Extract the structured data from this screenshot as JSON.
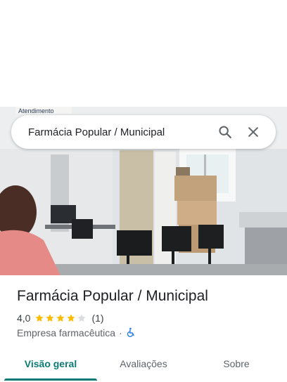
{
  "search": {
    "query": "Farmácia Popular / Municipal",
    "search_icon": "search-icon",
    "close_icon": "close-icon"
  },
  "photo": {
    "sign_text": "Atendimento"
  },
  "place": {
    "name": "Farmácia Popular / Municipal",
    "rating": "4,0",
    "rating_value": 4.0,
    "stars_filled": 4,
    "stars_total": 5,
    "review_count": "(1)",
    "category": "Empresa farmacêutica",
    "separator": "·",
    "accessibility_icon": "wheelchair-icon",
    "colors": {
      "star": "#fbbc04",
      "star_empty": "#dadce0",
      "accessibility": "#1a73e8",
      "accent": "#0b7a75"
    }
  },
  "tabs": [
    {
      "label": "Visão geral",
      "active": true
    },
    {
      "label": "Avaliações",
      "active": false
    },
    {
      "label": "Sobre",
      "active": false
    }
  ]
}
